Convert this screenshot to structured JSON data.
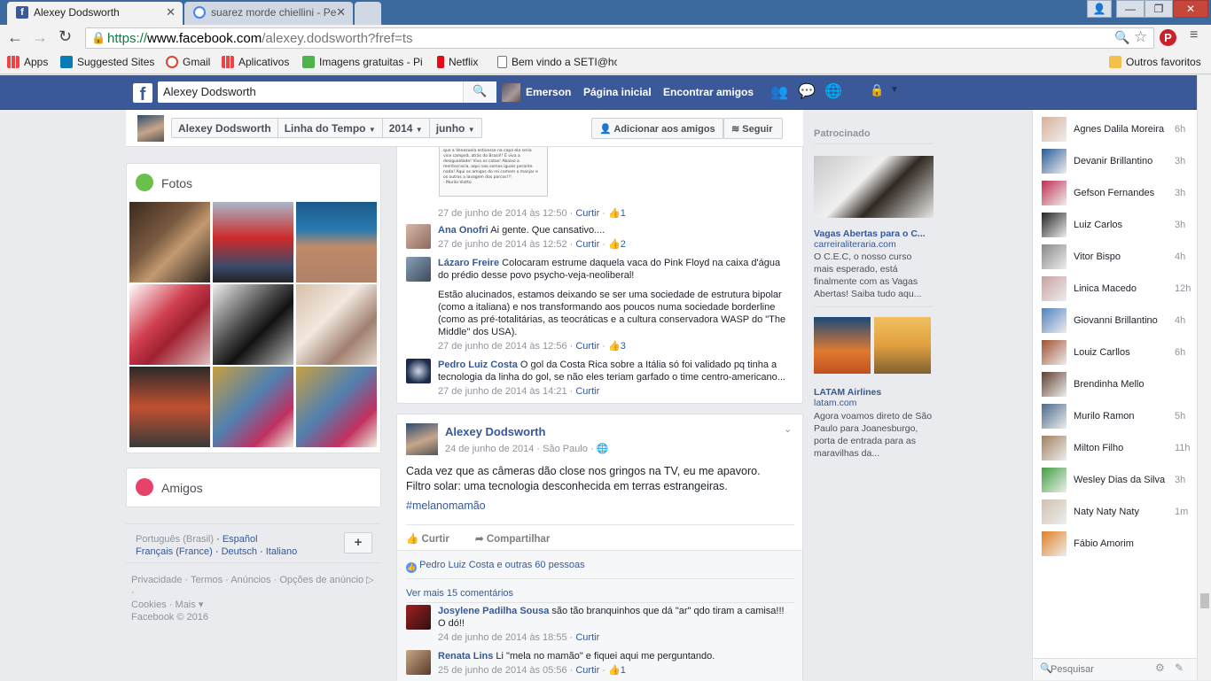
{
  "browser": {
    "tabs": [
      {
        "title": "Alexey Dodsworth"
      },
      {
        "title": "suarez morde chiellini - Pe"
      }
    ],
    "url_prefix": "https://",
    "url_host": "www.facebook.com",
    "url_path": "/alexey.dodsworth?fref=ts",
    "bookmarks": [
      "Apps",
      "Suggested Sites",
      "Gmail",
      "Aplicativos",
      "Imagens gratuitas - Pi",
      "Netflix",
      "Bem vindo a SETI@hc"
    ],
    "other_bookmarks": "Outros favoritos"
  },
  "fb": {
    "search_value": "Alexey Dodsworth",
    "user": "Emerson",
    "nav_home": "Página inicial",
    "nav_friends": "Encontrar amigos"
  },
  "timeline": {
    "name": "Alexey Dodsworth",
    "timeline_label": "Linha do Tempo",
    "year": "2014",
    "month": "junho",
    "add_friend": "Adicionar aos amigos",
    "follow": "Seguir"
  },
  "left": {
    "photos_title": "Fotos",
    "friends_title": "Amigos",
    "languages": [
      "Português (Brasil)",
      "Español",
      "Français (France)",
      "Deutsch",
      "Italiano"
    ],
    "footer_links": [
      "Privacidade",
      "Termos",
      "Anúncios",
      "Opções de anúncio",
      "Cookies",
      "Mais"
    ],
    "copyright": "Facebook © 2016",
    "plus": "+"
  },
  "feed": {
    "screenshot_text": [
      "que a Venezuela estivesse na copa ela seria",
      "vice campeã, atrás do Brasil!! É viva a",
      "desigualdade! Viva os cotas! Abaixo a",
      "meritocracia, aqui nao somos iguais perante",
      "nada! Aqui os amigos do rei comem o manjar e",
      "os outros a lavagem dos porcos!!!",
      "- Murilo Viotto"
    ],
    "top_meta": {
      "date": "27 de junho de 2014 às 12:50",
      "like": "Curtir",
      "count": "1"
    },
    "comments_a": [
      {
        "name": "Ana Onofri",
        "text": "Ai gente. Que cansativo....",
        "date": "27 de junho de 2014 às 12:52",
        "like": "Curtir",
        "count": "2"
      },
      {
        "name": "Lázaro Freire",
        "text": "Colocaram estrume daquela vaca do Pink Floyd na caixa d'água do prédio desse povo psycho-veja-neoliberal!",
        "text2": "Estão alucinados, estamos deixando se ser uma sociedade de estrutura bipolar (como a italiana) e nos transformando aos poucos numa sociedade borderline (como as pré-totalitárias, as teocráticas e a cultura conservadora WASP do \"The Middle\" dos USA).",
        "date": "27 de junho de 2014 às 12:56",
        "like": "Curtir",
        "count": "3"
      },
      {
        "name": "Pedro Luiz Costa",
        "text": "O gol da Costa Rica sobre a Itália só foi validado pq tinha a tecnologia da linha do gol, se não eles teriam garfado o time centro-americano...",
        "date": "27 de junho de 2014 às 14:21",
        "like": "Curtir",
        "count": ""
      }
    ],
    "post": {
      "author": "Alexey Dodsworth",
      "date": "24 de junho de 2014",
      "place": "São Paulo",
      "line1": "Cada vez que as câmeras dão close nos gringos na TV, eu me apavoro.",
      "line2": "Filtro solar: uma tecnologia desconhecida em terras estrangeiras.",
      "hashtag": "#melanomamão",
      "like": "Curtir",
      "share": "Compartilhar",
      "likes_summary": "Pedro Luiz Costa e outras 60 pessoas",
      "more_comments": "Ver mais 15 comentários"
    },
    "comments_b": [
      {
        "name": "Josylene Padilha Sousa",
        "text": "são tão branquinhos que dá \"ar\" qdo tiram a camisa!!! O dó!!",
        "date": "24 de junho de 2014 às 18:55",
        "like": "Curtir",
        "count": ""
      },
      {
        "name": "Renata Lins",
        "text": "Li \"mela no mamão\" e fiquei aqui me perguntando.",
        "date": "25 de junho de 2014 às 05:56",
        "like": "Curtir",
        "count": "1"
      }
    ]
  },
  "ads": {
    "title": "Patrocinado",
    "ad1": {
      "headline": "Vagas Abertas para o C...",
      "domain": "carreiraliteraria.com",
      "text": "O C.E.C, o nosso curso mais esperado, está finalmente com as Vagas Abertas! Saiba tudo aqu..."
    },
    "ad2": {
      "headline": "LATAM Airlines",
      "domain": "latam.com",
      "text": "Agora voamos direto de São Paulo para Joanesburgo, porta de entrada para as maravilhas da..."
    }
  },
  "chat": {
    "friends": [
      {
        "name": "Agnes Dalila Moreira",
        "time": "6h"
      },
      {
        "name": "Devanir Brillantino",
        "time": "3h"
      },
      {
        "name": "Gefson Fernandes",
        "time": "3h"
      },
      {
        "name": "Luiz Carlos",
        "time": "3h"
      },
      {
        "name": "Vitor Bispo",
        "time": "4h"
      },
      {
        "name": "Linica Macedo",
        "time": "12h"
      },
      {
        "name": "Giovanni Brillantino",
        "time": "4h"
      },
      {
        "name": "Louiz Carllos",
        "time": "6h"
      },
      {
        "name": "Brendinha Mello",
        "time": ""
      },
      {
        "name": "Murilo Ramon",
        "time": "5h"
      },
      {
        "name": "Milton Filho",
        "time": "11h"
      },
      {
        "name": "Wesley Dias da Silva",
        "time": "3h"
      },
      {
        "name": "Naty Naty Naty",
        "time": "1m"
      },
      {
        "name": "Fábio Amorim",
        "time": ""
      }
    ],
    "search_placeholder": "Pesquisar"
  }
}
